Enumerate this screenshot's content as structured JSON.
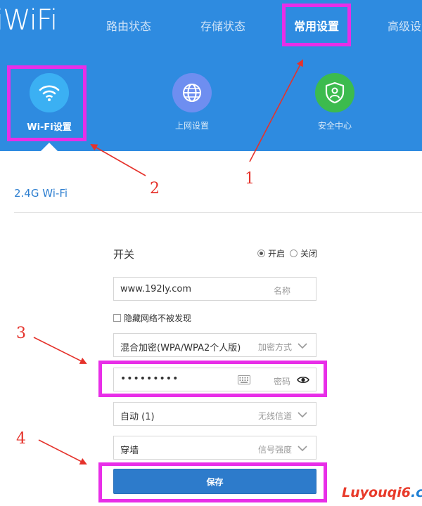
{
  "logo": "iWiFi",
  "nav": {
    "items": [
      "路由状态",
      "存储状态",
      "常用设置",
      "高级设"
    ],
    "active_index": 2
  },
  "functions": [
    {
      "label": "Wi-Fi设置",
      "icon": "wifi-icon",
      "color": "#3bb0f3"
    },
    {
      "label": "上网设置",
      "icon": "globe-icon",
      "color": "#6e8ef0"
    },
    {
      "label": "安全中心",
      "icon": "shield-user-icon",
      "color": "#3cbb4e"
    }
  ],
  "section_title": "2.4G Wi-Fi",
  "form": {
    "switch_label": "开关",
    "radio_on": "开启",
    "radio_off": "关闭",
    "ssid_value": "www.192ly.com",
    "ssid_hint": "名称",
    "hide_network_label": "隐藏网络不被发现",
    "encryption_value": "混合加密(WPA/WPA2个人版)",
    "encryption_hint": "加密方式",
    "password_value": "•••••••••",
    "password_hint": "密码",
    "channel_value": "自动 (1)",
    "channel_hint": "无线信道",
    "strength_value": "穿墙",
    "strength_hint": "信号强度",
    "save_label": "保存"
  },
  "annotations": {
    "num1": "1",
    "num2": "2",
    "num3": "3",
    "num4": "4"
  },
  "watermark": {
    "part1": "Luyouqi6",
    "part2": ".cn"
  },
  "colors": {
    "header_bg": "#2e8be0",
    "highlight": "#e82ee8",
    "arrow": "#e5322b",
    "button": "#2d7bcb"
  }
}
